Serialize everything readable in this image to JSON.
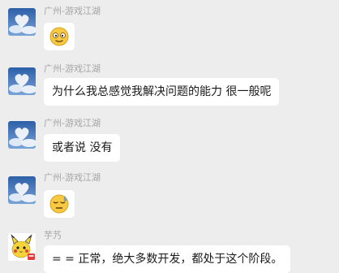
{
  "messages": [
    {
      "sender": "广州-游戏江湖",
      "avatar": "sky-heart-cloud-avatar",
      "type": "emoji",
      "emoji": "squinting-face-emoji"
    },
    {
      "sender": "广州-游戏江湖",
      "avatar": "sky-heart-cloud-avatar",
      "type": "text",
      "text": "为什么我总感觉我解决问题的能力 很一般呢"
    },
    {
      "sender": "广州-游戏江湖",
      "avatar": "sky-heart-cloud-avatar",
      "type": "text",
      "text": "或者说 没有"
    },
    {
      "sender": "广州-游戏江湖",
      "avatar": "sky-heart-cloud-avatar",
      "type": "emoji",
      "emoji": "sweat-face-emoji"
    },
    {
      "sender": "芋艿",
      "avatar": "pikachu-avatar",
      "type": "text",
      "text": "= = 正常，绝大多数开发，都处于这个阶段。"
    }
  ],
  "colors": {
    "background": "#ededed",
    "bubble": "#ffffff",
    "sender_name": "#a5a5a5",
    "text": "#191919",
    "emoji_yellow": "#f7c841"
  }
}
